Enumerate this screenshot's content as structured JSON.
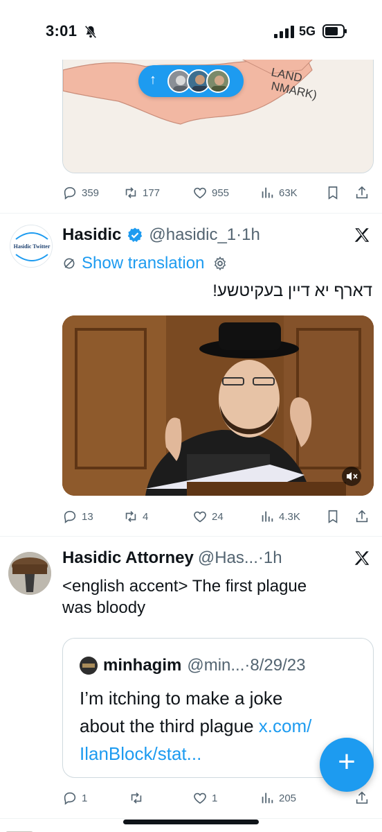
{
  "status_bar": {
    "time": "3:01",
    "network": "5G"
  },
  "colors": {
    "accent": "#1d9bf0",
    "muted": "#536471",
    "text": "#0f1419",
    "verified": "#1d9bf0"
  },
  "top_tweet": {
    "map_labels": [
      "LAND",
      "NMARK)"
    ],
    "new_posts_arrow": "↑",
    "actions": {
      "replies": "359",
      "reposts": "177",
      "likes": "955",
      "views": "63K"
    }
  },
  "tweet1": {
    "name": "Hasidic",
    "handle": "@hasidic_1",
    "time": "·1h",
    "avatar_text": "Hasidic Twitter",
    "translation": "Show translation",
    "text": "דארף יא דיין בעקיטשע!",
    "actions": {
      "replies": "13",
      "reposts": "4",
      "likes": "24",
      "views": "4.3K"
    }
  },
  "tweet2": {
    "name": "Hasidic Attorney",
    "handle": "@Has...",
    "time": "·1h",
    "text_line1": "<english accent> The first plague",
    "text_line2": "was bloody",
    "quote": {
      "name": "minhagim",
      "handle": "@min...",
      "date": "·8/29/23",
      "line1": "I’m itching to make a joke",
      "line2": "about the third plague ",
      "link1": "x.com/",
      "link2": "IlanBlock/stat..."
    },
    "actions": {
      "replies": "1",
      "reposts": "",
      "likes": "1",
      "views": "205"
    }
  },
  "fab": {
    "label": "+"
  },
  "icons": [
    "bell-off-icon",
    "signal-icon",
    "battery-icon",
    "reply-icon",
    "repost-icon",
    "like-icon",
    "views-icon",
    "bookmark-icon",
    "share-icon",
    "verified-icon",
    "x-logo-icon",
    "translate-icon",
    "gear-icon",
    "mute-icon",
    "plus-icon"
  ]
}
